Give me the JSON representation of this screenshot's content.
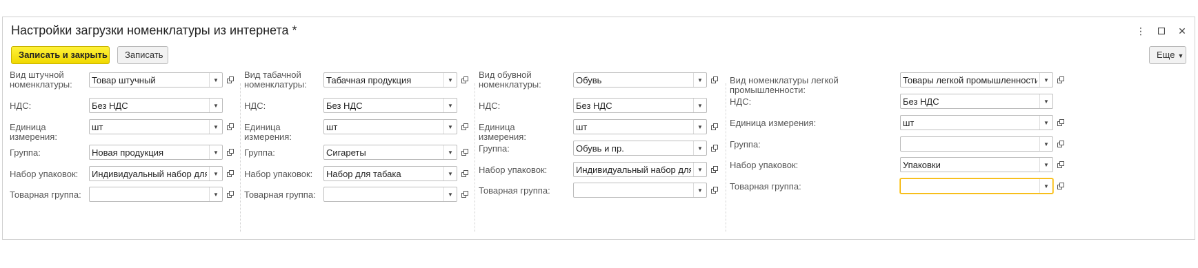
{
  "window": {
    "title": "Настройки загрузки номенклатуры из интернета *",
    "icons": [
      "more-vert-icon",
      "maximize-icon",
      "close-icon"
    ]
  },
  "toolbar": {
    "save_close_label": "Записать и закрыть",
    "save_label": "Записать",
    "more_label": "Еще"
  },
  "columns": [
    {
      "id": "piece",
      "fields": [
        {
          "label": "Вид штучной номенклатуры:",
          "value": "Товар штучный"
        },
        {
          "label": "НДС:",
          "value": "Без НДС"
        },
        {
          "label": "Единица измерения:",
          "value": "шт"
        },
        {
          "label": "Группа:",
          "value": "Новая продукция"
        },
        {
          "label": "Набор упаковок:",
          "value": "Индивидуальный набор для ном"
        },
        {
          "label": "Товарная группа:",
          "value": ""
        }
      ]
    },
    {
      "id": "tobacco",
      "fields": [
        {
          "label": "Вид табачной номенклатуры:",
          "value": "Табачная продукция"
        },
        {
          "label": "НДС:",
          "value": "Без НДС"
        },
        {
          "label": "Единица измерения:",
          "value": "шт"
        },
        {
          "label": "Группа:",
          "value": "Сигареты"
        },
        {
          "label": "Набор упаковок:",
          "value": "Набор для табака"
        },
        {
          "label": "Товарная группа:",
          "value": ""
        }
      ]
    },
    {
      "id": "shoes",
      "fields": [
        {
          "label": "Вид обувной номенклатуры:",
          "value": "Обувь"
        },
        {
          "label": "НДС:",
          "value": "Без НДС"
        },
        {
          "label": "Единица измерения:",
          "value": "шт"
        },
        {
          "label": "Группа:",
          "value": "Обувь и пр."
        },
        {
          "label": "Набор упаковок:",
          "value": "Индивидуальный набор для ном"
        },
        {
          "label": "Товарная группа:",
          "value": ""
        }
      ]
    },
    {
      "id": "light-industry",
      "fields": [
        {
          "label": "Вид номенклатуры легкой промышленности:",
          "value": "Товары легкой промышленности"
        },
        {
          "label": "НДС:",
          "value": "Без НДС"
        },
        {
          "label": "Единица измерения:",
          "value": "шт"
        },
        {
          "label": "Группа:",
          "value": ""
        },
        {
          "label": "Набор упаковок:",
          "value": "Упаковки"
        },
        {
          "label": "Товарная группа:",
          "value": ""
        }
      ]
    }
  ]
}
